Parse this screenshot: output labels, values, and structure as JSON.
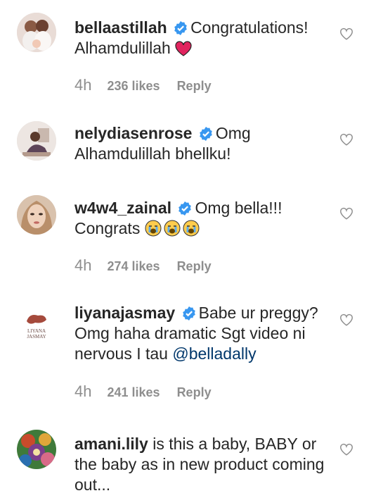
{
  "comments": [
    {
      "username": "bellaastillah",
      "verified": true,
      "text": "Congratulations! Alhamdulillah",
      "time": "4h",
      "likes": "236 likes",
      "reply": "Reply"
    },
    {
      "username": "nelydiasenrose",
      "verified": true,
      "text": "Omg Alhamdulillah bhellku!"
    },
    {
      "username": "w4w4_zainal",
      "verified": true,
      "text": "Omg bella!!! Congrats",
      "time": "4h",
      "likes": "274 likes",
      "reply": "Reply"
    },
    {
      "username": "liyanajasmay",
      "verified": true,
      "text": "Babe ur preggy? Omg haha dramatic Sgt video ni nervous I tau",
      "mention": "@belladally",
      "avatar_text_1": "LIYANA",
      "avatar_text_2": "JASMAY",
      "time": "4h",
      "likes": "241 likes",
      "reply": "Reply"
    },
    {
      "username": "amani.lily",
      "verified": false,
      "text": "is this a baby, BABY or the baby as in new product coming out..."
    }
  ],
  "colors": {
    "verified": "#3897f0",
    "meta": "#8e8e8e",
    "mention": "#00376b",
    "emoji_heart": "#e0245e"
  },
  "icons": [
    "verified-badge-icon",
    "heart-outline-icon",
    "red-heart-emoji",
    "crying-face-emoji"
  ]
}
